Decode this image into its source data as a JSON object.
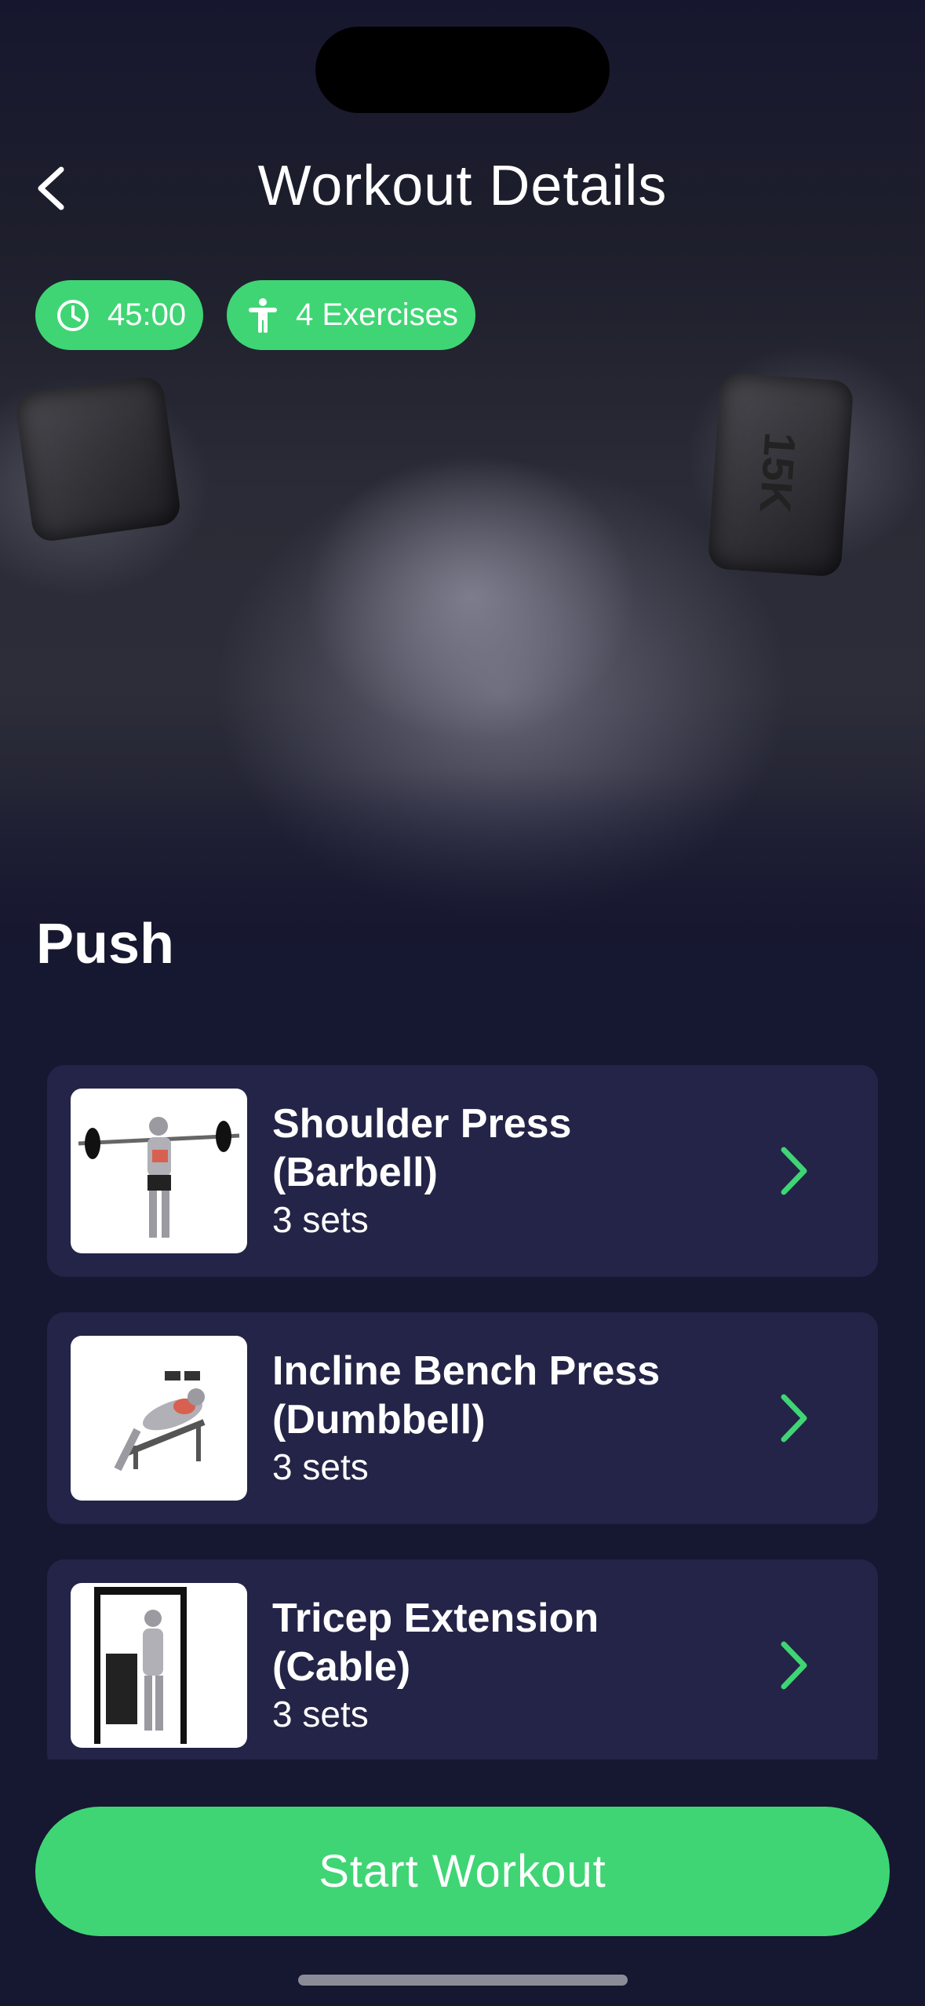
{
  "header": {
    "title": "Workout Details"
  },
  "chips": [
    {
      "icon": "clock-icon",
      "label": "45:00"
    },
    {
      "icon": "person-icon",
      "label": "4 Exercises"
    }
  ],
  "hero": {
    "weight_marking": "15K"
  },
  "workout": {
    "name": "Push"
  },
  "exercises": [
    {
      "name": "Shoulder Press (Barbell)",
      "sets": "3 sets"
    },
    {
      "name": "Incline Bench Press (Dumbbell)",
      "sets": "3 sets"
    },
    {
      "name": "Tricep Extension (Cable)",
      "sets": "3 sets"
    }
  ],
  "actions": {
    "start_label": "Start Workout"
  },
  "colors": {
    "accent": "#3fd574",
    "background": "#161730",
    "card": "#232447"
  }
}
